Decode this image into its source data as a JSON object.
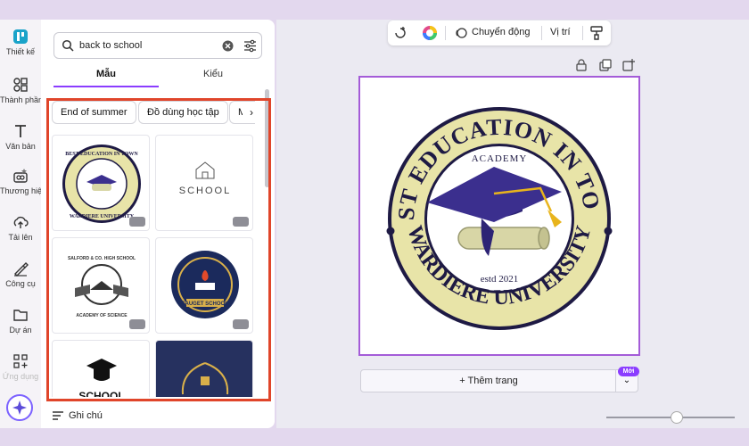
{
  "sidebar": {
    "items": [
      {
        "label": "Thiết kế",
        "icon": "design-icon"
      },
      {
        "label": "Thành phần",
        "icon": "elements-icon"
      },
      {
        "label": "Văn bản",
        "icon": "text-icon"
      },
      {
        "label": "Thương hiệu",
        "icon": "brand-icon"
      },
      {
        "label": "Tải lên",
        "icon": "upload-icon"
      },
      {
        "label": "Công cụ",
        "icon": "tools-icon"
      },
      {
        "label": "Dự án",
        "icon": "folder-icon"
      },
      {
        "label": "Ứng dụng",
        "icon": "apps-icon"
      }
    ]
  },
  "search": {
    "value": "back to school"
  },
  "tabs": [
    {
      "label": "Mẫu"
    },
    {
      "label": "Kiểu"
    }
  ],
  "chips": [
    "End of summer",
    "Đồ dùng học tập",
    "Mẹ"
  ],
  "templates": [
    {
      "name": "template-best-education",
      "title": "BEST EDUCATION IN TOWN",
      "sub": "WARDIERE UNIVERSITY"
    },
    {
      "name": "template-school",
      "title": "SCHOOL"
    },
    {
      "name": "template-salford",
      "title": "SALFORD & CO. HIGH SCHOOL",
      "sub": "ACADEMY OF SCIENCE"
    },
    {
      "name": "template-fauget",
      "title": "FAUGET SCHOOL"
    },
    {
      "name": "template-school-cap",
      "title": "SCHOOL"
    },
    {
      "name": "template-navy-wreath"
    }
  ],
  "notes": {
    "label": "Ghi chú"
  },
  "context_toolbar": {
    "animate": "Chuyển động",
    "position": "Vị trí"
  },
  "logo": {
    "top_text": "BEST EDUCATION IN TOWN",
    "academy": "ACADEMY",
    "bottom_text": "WARDIERE UNIVERSITY",
    "established": "estd 2021"
  },
  "add_page": {
    "label": "+ Thêm trang",
    "new_badge": "Mới"
  },
  "zoom": {
    "level": 0.53
  },
  "colors": {
    "accent": "#8b3dff",
    "highlight": "#e0452a",
    "logo_cream": "#e8e4a8",
    "logo_navy": "#1e1a44",
    "cap_purple": "#3b2f8e",
    "tassel_gold": "#e8b41c"
  }
}
